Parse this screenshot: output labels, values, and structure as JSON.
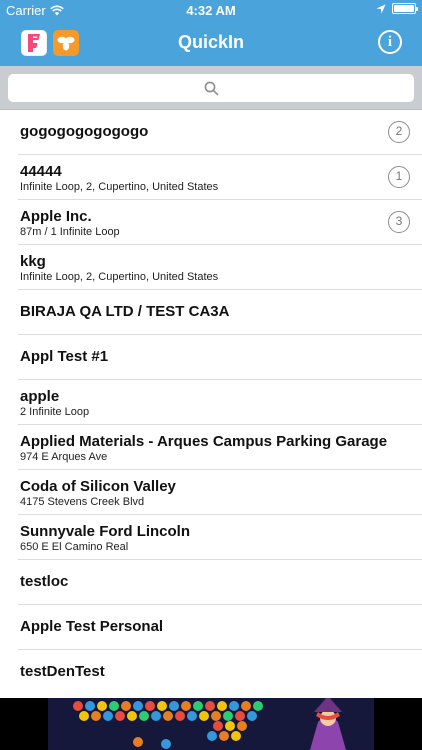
{
  "status_bar": {
    "carrier": "Carrier",
    "time": "4:32 AM"
  },
  "nav": {
    "title": "QuickIn",
    "info_label": "i"
  },
  "search": {
    "placeholder": ""
  },
  "venues": [
    {
      "name": "gogogogogogogo",
      "address": "",
      "badge": "2"
    },
    {
      "name": "44444",
      "address": "Infinite Loop, 2, Cupertino, United States",
      "badge": "1"
    },
    {
      "name": "Apple Inc.",
      "address": "87m / 1 Infinite Loop",
      "badge": "3"
    },
    {
      "name": "kkg",
      "address": "Infinite Loop, 2, Cupertino, United States",
      "badge": ""
    },
    {
      "name": "BIRAJA QA LTD / TEST CA3A",
      "address": "",
      "badge": ""
    },
    {
      "name": "Appl Test #1",
      "address": "",
      "badge": ""
    },
    {
      "name": "apple",
      "address": "2 Infinite Loop",
      "badge": ""
    },
    {
      "name": "Applied Materials - Arques Campus Parking Garage",
      "address": "974 E Arques Ave",
      "badge": ""
    },
    {
      "name": "Coda of Silicon Valley",
      "address": "4175 Stevens Creek Blvd",
      "badge": ""
    },
    {
      "name": "Sunnyvale Ford Lincoln",
      "address": "650 E El Camino Real",
      "badge": ""
    },
    {
      "name": "testloc",
      "address": "",
      "badge": ""
    },
    {
      "name": "Apple Test Personal",
      "address": "",
      "badge": ""
    },
    {
      "name": "testDenTest",
      "address": "",
      "badge": ""
    }
  ],
  "colors": {
    "nav_bar": "#4aa3db",
    "search_bar": "#c9cdd2",
    "swarm_icon": "#f59a2a",
    "foursquare_icon": "#f94877"
  },
  "icons": {
    "foursquare": "foursquare-app-icon",
    "swarm": "swarm-app-icon",
    "search": "search-icon",
    "info": "info-icon"
  }
}
